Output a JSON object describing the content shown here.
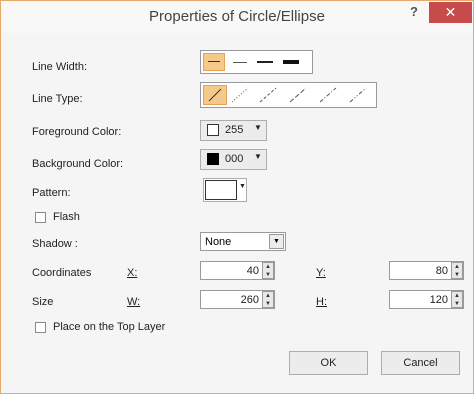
{
  "dialog": {
    "title": "Properties of Circle/Ellipse",
    "help_label": "?",
    "close_label": "✕"
  },
  "fields": {
    "line_width_label": "Line Width:",
    "line_type_label": "Line Type:",
    "foreground_label": "Foreground Color:",
    "foreground_value": "255",
    "background_label": "Background Color:",
    "background_value": "000",
    "pattern_label": "Pattern:",
    "flash_label": "Flash",
    "shadow_label": "Shadow :",
    "shadow_value": "None",
    "coordinates_label": "Coordinates",
    "x_label": "X:",
    "x_value": "40",
    "y_label": "Y:",
    "y_value": "80",
    "size_label": "Size",
    "w_label": "W:",
    "w_value": "260",
    "h_label": "H:",
    "h_value": "120",
    "top_layer_label": "Place on the Top Layer"
  },
  "buttons": {
    "ok_label": "OK",
    "cancel_label": "Cancel"
  },
  "colors": {
    "foreground_swatch": "#ffffff",
    "background_swatch": "#000000",
    "close_button": "#c74b4b",
    "selected_orange": "#f5c98a"
  },
  "icons": [
    "dropdown-arrow-icon",
    "spin-up-icon",
    "spin-down-icon",
    "checkbox-icon"
  ]
}
